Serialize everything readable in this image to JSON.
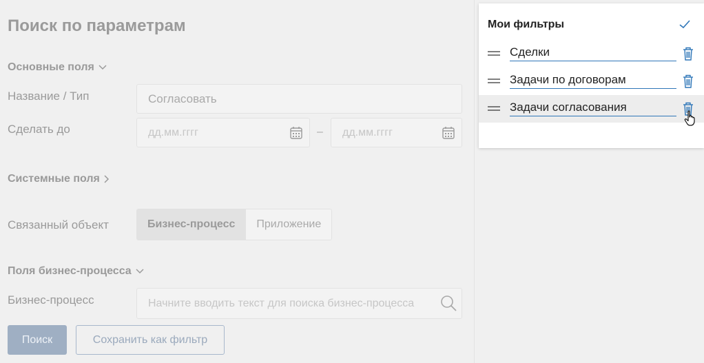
{
  "form": {
    "title": "Поиск по параметрам",
    "sections": {
      "main": "Основные поля",
      "system": "Системные поля",
      "process": "Поля бизнес-процесса"
    },
    "fields": {
      "name_label": "Название / Тип",
      "name_value": "Согласовать",
      "due_label": "Сделать до",
      "date_from_placeholder": "дд.мм.гггг",
      "date_separator": "–",
      "date_to_placeholder": "дд.мм.гггг",
      "linked_label": "Связанный объект",
      "linked_options": [
        "Бизнес-процесс",
        "Приложение"
      ],
      "linked_selected": "Бизнес-процесс",
      "bp_label": "Бизнес-процесс",
      "bp_placeholder": "Начните вводить текст для поиска бизнес-процесса"
    },
    "buttons": {
      "search": "Поиск",
      "save_filter": "Сохранить как фильтр"
    }
  },
  "filters_panel": {
    "title": "Мои фильтры",
    "items": [
      {
        "name": "Сделки"
      },
      {
        "name": "Задачи по договорам"
      },
      {
        "name": "Задачи согласования",
        "hovered": true
      }
    ]
  },
  "colors": {
    "accent": "#2e76b8",
    "trash_icon": "#2e76b8",
    "primary_button": "#9fafc3"
  }
}
